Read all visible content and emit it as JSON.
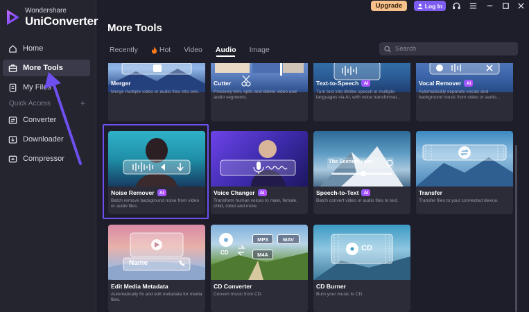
{
  "brand": {
    "line1": "Wondershare",
    "line2": "UniConverter"
  },
  "topbar": {
    "upgrade": "Upgrade",
    "login": "Log In"
  },
  "sidebar": {
    "items": [
      {
        "label": "Home",
        "icon": "home-icon"
      },
      {
        "label": "More Tools",
        "icon": "toolbox-icon",
        "active": true
      },
      {
        "label": "My Files",
        "icon": "file-icon"
      },
      {
        "label": "Converter",
        "icon": "converter-icon"
      },
      {
        "label": "Downloader",
        "icon": "download-icon"
      },
      {
        "label": "Compressor",
        "icon": "compress-icon"
      }
    ],
    "quick_access": "Quick Access",
    "quick_add": "+"
  },
  "main": {
    "title": "More Tools",
    "tabs": [
      "Recently",
      "Hot",
      "Video",
      "Audio",
      "Image"
    ],
    "active_tab": "Audio",
    "search_placeholder": "Search"
  },
  "cards": [
    {
      "name": "Merger",
      "ai": false,
      "desc": "Merge multiple video or audio files into one."
    },
    {
      "name": "Cutter",
      "ai": false,
      "desc": "Precisely trim, split, and delete video and audio segments."
    },
    {
      "name": "Text-to-Speech",
      "ai": true,
      "desc": "Turn text into lifelike speech in multiple languages via AI, with voice transformat..."
    },
    {
      "name": "Vocal Remover",
      "ai": true,
      "desc": "Automatically separate vocals and background music from video or audio..."
    },
    {
      "name": "Noise Remover",
      "ai": true,
      "desc": "Batch remove background noise from video or audio files."
    },
    {
      "name": "Voice Changer",
      "ai": true,
      "desc": "Transform human voices to male, female, child, robot and more."
    },
    {
      "name": "Speech-to-Text",
      "ai": true,
      "desc": "Batch convert video or audio files to text."
    },
    {
      "name": "Transfer",
      "ai": false,
      "desc": "Transfer files to your connected device."
    },
    {
      "name": "Edit Media Metadata",
      "ai": false,
      "desc": "Automatically fix and edit metadata for media files."
    },
    {
      "name": "CD Converter",
      "ai": false,
      "desc": "Convert music from CD."
    },
    {
      "name": "CD Burner",
      "ai": false,
      "desc": "Burn your music to CD."
    }
  ],
  "thumb_text": {
    "speech_to_text": "The Scenery Here",
    "metadata": "Name",
    "cd_converter_cd": "CD",
    "cd_converter_formats": [
      "MP3",
      "MAV",
      "M4A"
    ],
    "cd_burner": "CD"
  },
  "ai_badge": "AI",
  "colors": {
    "accent": "#7d5cf0",
    "upgrade": "#f6c08a",
    "background": "#1e1e2a",
    "card": "#2c2c38"
  }
}
